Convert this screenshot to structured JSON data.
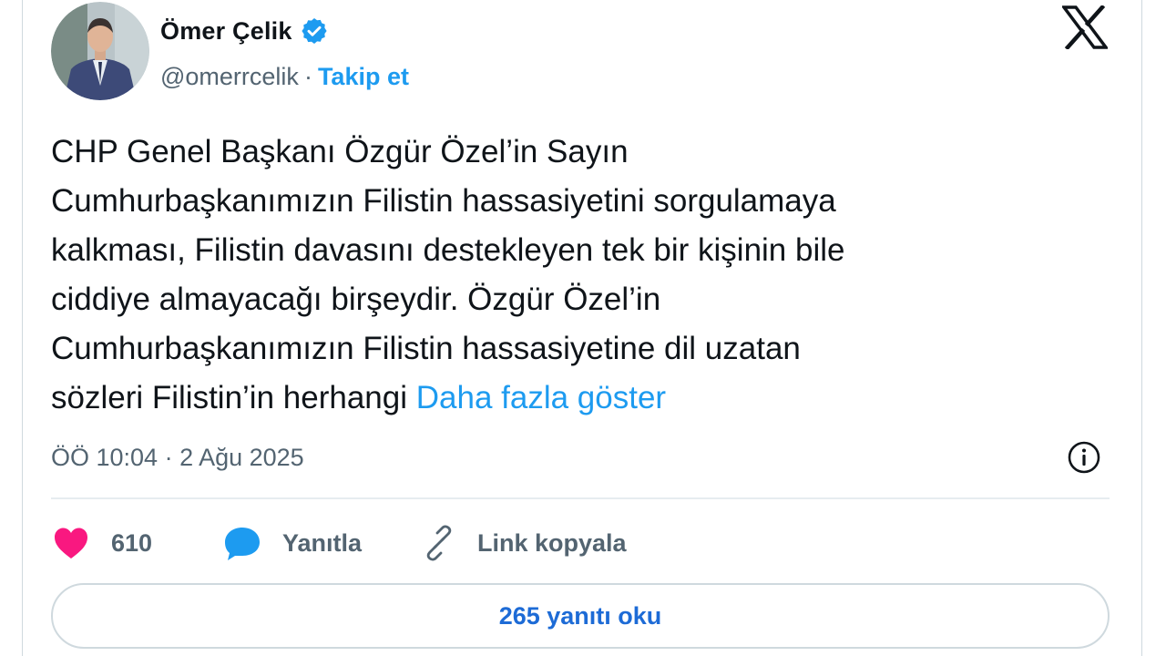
{
  "author": {
    "name": "Ömer Çelik",
    "handle": "@omerrcelik",
    "separator": "·",
    "follow_label": "Takip et",
    "verified": true
  },
  "tweet": {
    "text": "CHP Genel Başkanı Özgür Özel’in Sayın\nCumhurbaşkanımızın Filistin hassasiyetini sorgulamaya\nkalkması, Filistin davasını destekleyen tek bir kişinin bile\nciddiye almayacağı birşeydir. Özgür Özel’in\nCumhurbaşkanımızın Filistin hassasiyetine dil uzatan\nsözleri Filistin’in herhangi ",
    "show_more": "Daha fazla göster",
    "timestamp": "ÖÖ 10:04 · 2 Ağu 2025"
  },
  "actions": {
    "like_count": "610",
    "reply_label": "Yanıtla",
    "copy_link_label": "Link kopyala"
  },
  "replies_button": "265 yanıtı oku",
  "icons": {
    "verified": "verified-badge-icon",
    "platform": "x-logo-icon",
    "info": "info-icon",
    "like": "heart-icon",
    "reply": "speech-bubble-icon",
    "link": "link-icon"
  },
  "colors": {
    "accent": "#1d9bf0",
    "like": "#f91880",
    "text": "#0f1419",
    "secondary": "#536471"
  }
}
